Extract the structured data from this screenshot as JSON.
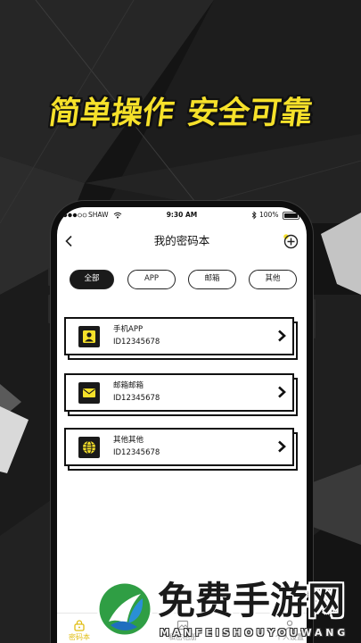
{
  "promo": {
    "headline_left": "简单操作",
    "headline_right": "安全可靠"
  },
  "status_bar": {
    "carrier": "SHAW",
    "time": "9:30 AM",
    "battery": "100%"
  },
  "nav": {
    "title": "我的密码本",
    "back_icon": "chevron-left-icon",
    "add_icon": "add-circle-icon"
  },
  "filters": [
    {
      "label": "全部",
      "selected": true
    },
    {
      "label": "APP",
      "selected": false
    },
    {
      "label": "邮箱",
      "selected": false
    },
    {
      "label": "其他",
      "selected": false
    }
  ],
  "entries": [
    {
      "title": "手机APP",
      "id": "ID12345678",
      "icon": "user-icon"
    },
    {
      "title": "邮箱邮箱",
      "id": "ID12345678",
      "icon": "mail-icon"
    },
    {
      "title": "其他其他",
      "id": "ID12345678",
      "icon": "globe-icon"
    }
  ],
  "tabs": [
    {
      "label": "密码本",
      "active": true,
      "icon": "lock-icon"
    },
    {
      "label": "私密相册",
      "active": false,
      "icon": "photo-icon"
    },
    {
      "label": "个人设置",
      "active": false,
      "icon": "user-settings-icon"
    }
  ],
  "watermark": {
    "name": "免费手游网",
    "pinyin": "MANFEISHOUYOUWANG"
  },
  "colors": {
    "accent": "#f6e12a",
    "background": "#141414",
    "text": "#111111"
  }
}
